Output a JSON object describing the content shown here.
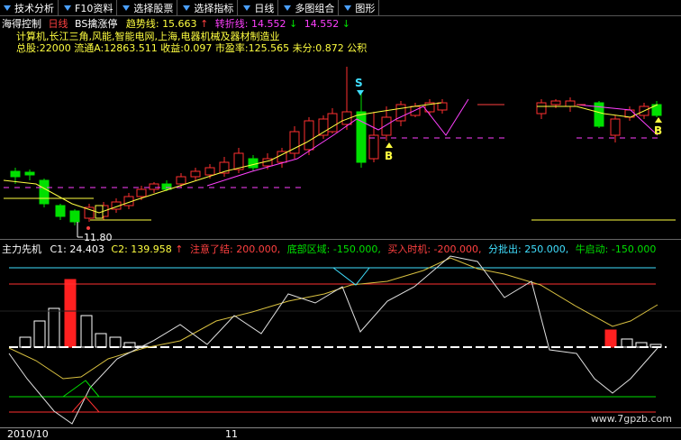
{
  "toolbar": [
    {
      "label": "技术分析",
      "name": "tab-technical-analysis"
    },
    {
      "label": "F10资料",
      "name": "tab-f10"
    },
    {
      "label": "选择股票",
      "name": "tab-select-stock"
    },
    {
      "label": "选择指标",
      "name": "tab-select-indicator"
    },
    {
      "label": "日线",
      "name": "tab-daily"
    },
    {
      "label": "多图组合",
      "name": "tab-multi-chart"
    },
    {
      "label": "图形",
      "name": "tab-graph"
    }
  ],
  "info": {
    "stock_name": "海得控制",
    "period": "日线",
    "bs_label": "BS擒涨停",
    "trend_label": "趋势线:",
    "trend_value": "15.663",
    "turn_label": "转折线:",
    "turn_value": "14.552",
    "turn_value2": "14.552",
    "sectors": "计算机,长江三角,风能,智能电网,上海,电器机械及器材制造业",
    "stats": "总股:22000  流通A:12863.511  收益:0.097  市盈率:125.565  未分:0.872  公积"
  },
  "markers": {
    "low_price": "11.80",
    "s_label": "S",
    "b_label": "B",
    "b_label2": "B"
  },
  "indicator": {
    "name": "主力先机",
    "c1_label": "C1:",
    "c1_value": "24.403",
    "c2_label": "C2:",
    "c2_value": "139.958",
    "attention": "注意了结: 200.000,",
    "bottom": "底部区域: -150.000,",
    "buy": "买入时机: -200.000,",
    "split": "分批出: 250.000,",
    "bull": "牛启动: -150.000"
  },
  "date_axis": {
    "label1": "2010/10",
    "label2": "11"
  },
  "watermark": "www.7gpzb.com",
  "colors": {
    "up": "#ff3030",
    "down": "#00e000",
    "trend": "#ffff40",
    "turn": "#ff40ff",
    "cyan": "#40e0ff"
  }
}
